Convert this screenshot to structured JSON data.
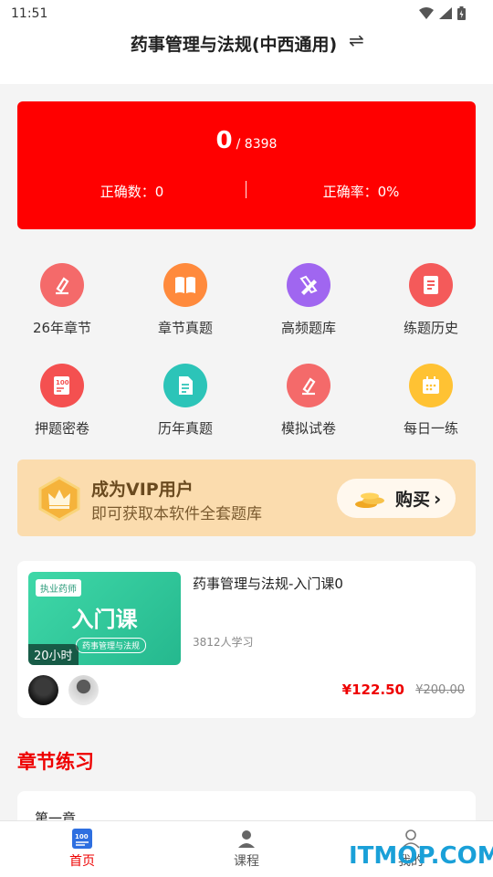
{
  "status_bar": {
    "time": "11:51"
  },
  "header": {
    "title": "药事管理与法规(中西通用)",
    "swap_icon": "swap-icon"
  },
  "stats": {
    "answered": "0",
    "total": "/ 8398",
    "correct_count": "正确数：0",
    "correct_rate": "正确率：0%"
  },
  "grid": [
    {
      "label": "26年章节",
      "icon": "pen-icon",
      "color": "#f46a6a"
    },
    {
      "label": "章节真题",
      "icon": "book-icon",
      "color": "#ff8a3c"
    },
    {
      "label": "高频题库",
      "icon": "pencil-ruler-icon",
      "color": "#a066f0"
    },
    {
      "label": "练题历史",
      "icon": "notebook-icon",
      "color": "#f45a5a"
    },
    {
      "label": "押题密卷",
      "icon": "exam-paper-icon",
      "color": "#f45050"
    },
    {
      "label": "历年真题",
      "icon": "document-icon",
      "color": "#2cc4b8"
    },
    {
      "label": "模拟试卷",
      "icon": "pen-icon",
      "color": "#f46a6a"
    },
    {
      "label": "每日一练",
      "icon": "calendar-icon",
      "color": "#ffc233"
    }
  ],
  "vip": {
    "title": "成为VIP用户",
    "subtitle": "即可获取本软件全套题库",
    "buy_label": "购买"
  },
  "course": {
    "thumb_tag": "执业药师",
    "thumb_main": "入门课",
    "thumb_sub": "药事管理与法规",
    "hours": "20小时",
    "title": "药事管理与法规-入门课0",
    "learners": "3812人学习",
    "price": "¥122.50",
    "old_price": "¥200.00"
  },
  "section": {
    "title": "章节练习",
    "first_chapter": "第一章"
  },
  "tabbar": {
    "home": "首页",
    "courses": "课程",
    "mine": "我的"
  },
  "watermark": "ITMOP.COM",
  "colors": {
    "accent": "#ff0000",
    "vip_bg": "#fbdcae"
  }
}
